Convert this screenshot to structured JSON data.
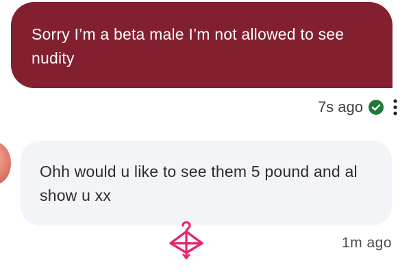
{
  "colors": {
    "outgoing_bubble": "#82202f",
    "incoming_bubble": "#f3f4f7",
    "read_check": "#1f7a3a",
    "accent_pink": "#e8236e"
  },
  "messages": {
    "outgoing": {
      "text": "Sorry I’m a beta male I’m not allowed to see nudity",
      "time": "7s ago",
      "status_icon": "check-circle-icon",
      "menu_icon": "more-vertical-icon"
    },
    "incoming": {
      "text": "Ohh would u like to see them 5 pound and al show u xx",
      "time": "1m ago",
      "avatar_icon": "avatar",
      "reaction_icon": "hanger-icon"
    }
  }
}
